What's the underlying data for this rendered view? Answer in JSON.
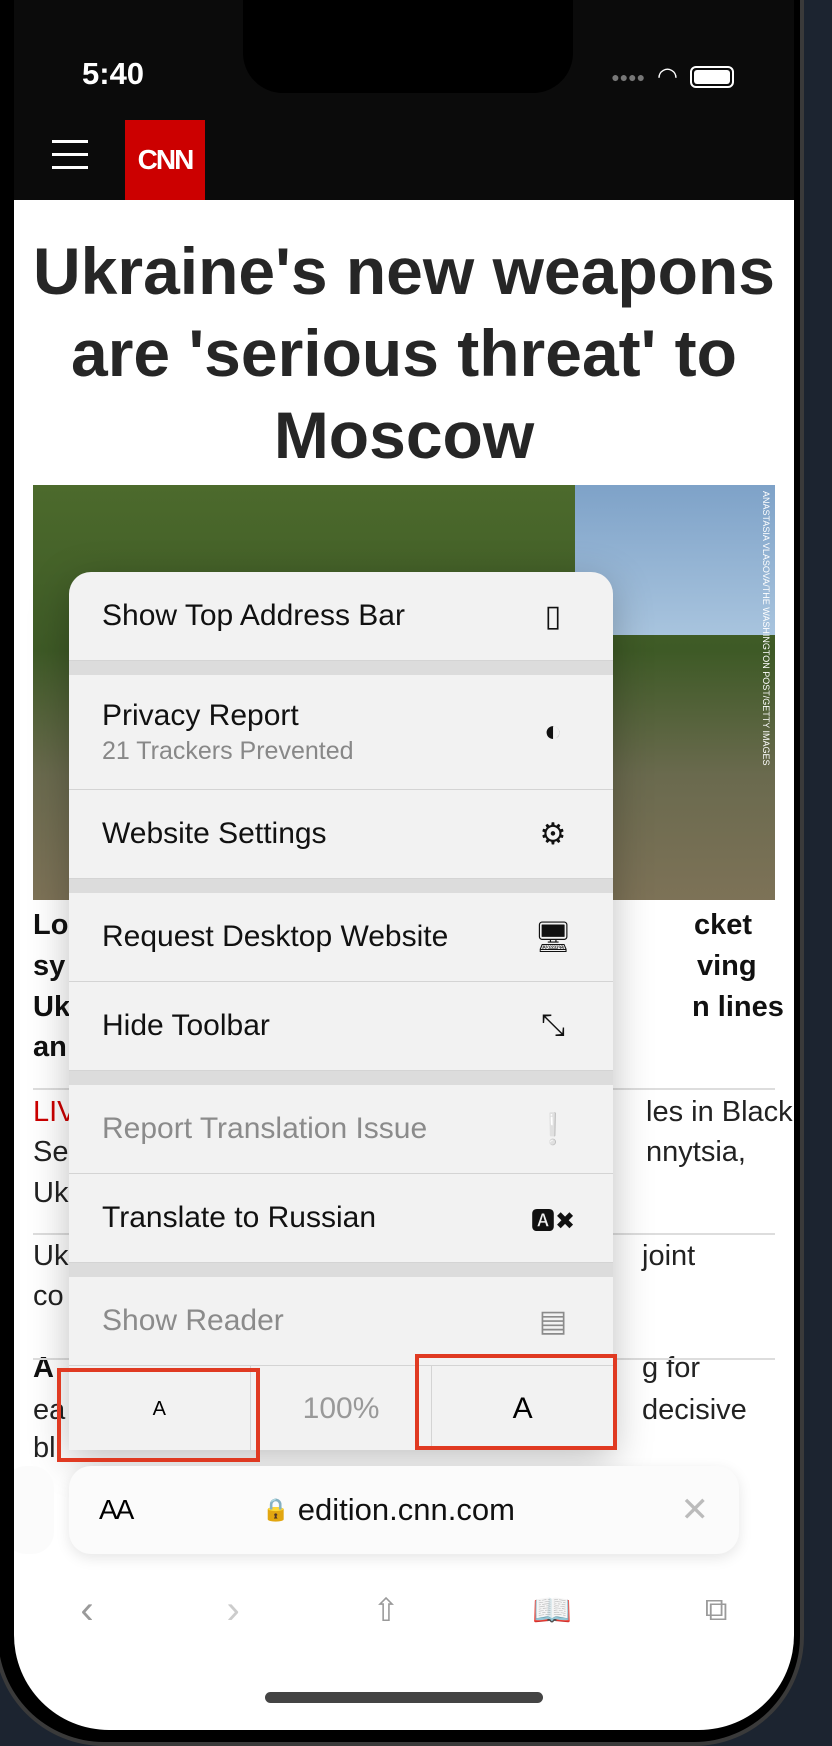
{
  "status": {
    "time": "5:40"
  },
  "site": {
    "logo": "CNN"
  },
  "article": {
    "headline": "Ukraine's new weapons are 'serious threat' to Moscow",
    "photo_credit": "ANASTASIA VLASOVA/THE WASHINGTON POST/GETTY IMAGES",
    "fragments_left": [
      "Lo",
      "sy",
      "Uk",
      "an",
      "LIV",
      "Se",
      "Uk",
      "Uk",
      "co",
      "A",
      "ea",
      "bl"
    ],
    "fragments_right": [
      "cket",
      "ving",
      "n lines",
      "les in Black",
      "nnytsia,",
      "joint",
      "g for",
      "decisive"
    ]
  },
  "menu": {
    "items": [
      {
        "label": "Show Top Address Bar",
        "icon": "address-bar-top-icon"
      },
      {
        "label": "Privacy Report",
        "sub": "21 Trackers Prevented",
        "icon": "shield-icon"
      },
      {
        "label": "Website Settings",
        "icon": "gear-icon"
      },
      {
        "label": "Request Desktop Website",
        "icon": "desktop-icon"
      },
      {
        "label": "Hide Toolbar",
        "icon": "expand-arrows-icon"
      },
      {
        "label": "Report Translation Issue",
        "icon": "exclamation-bubble-icon",
        "disabled": true
      },
      {
        "label": "Translate to Russian",
        "icon": "translate-icon"
      },
      {
        "label": "Show Reader",
        "icon": "reader-icon",
        "disabled": true
      }
    ],
    "zoom": {
      "smaller": "A",
      "level": "100%",
      "larger": "A"
    }
  },
  "addressbar": {
    "format_button": "AA",
    "url": "edition.cnn.com"
  },
  "colors": {
    "cnn_red": "#cc0000",
    "highlight": "#e03a22"
  }
}
